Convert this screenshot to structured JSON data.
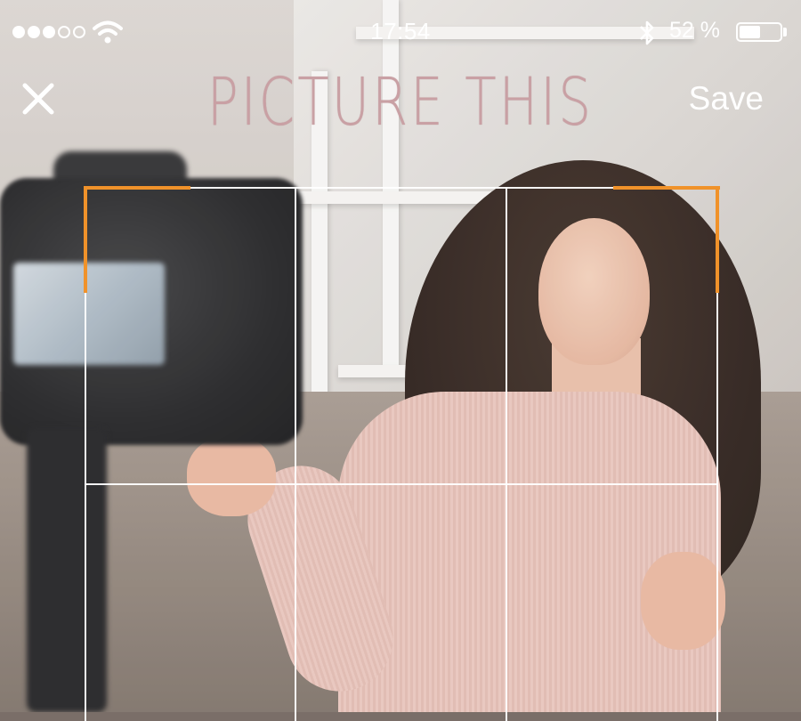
{
  "status_bar": {
    "signal_bars_total": 5,
    "signal_bars_filled": 3,
    "time": "17:54",
    "battery_percent_label": "52 %",
    "battery_level": 0.52
  },
  "header": {
    "close_icon": "close-icon",
    "title": "PICTURE THIS",
    "save_label": "Save"
  },
  "crop": {
    "grid": "3x3",
    "corner_handle_color": "#f0922a",
    "grid_line_color": "#ffffff"
  },
  "colors": {
    "title": "#c9a0a4",
    "status_text": "#ffffff"
  }
}
